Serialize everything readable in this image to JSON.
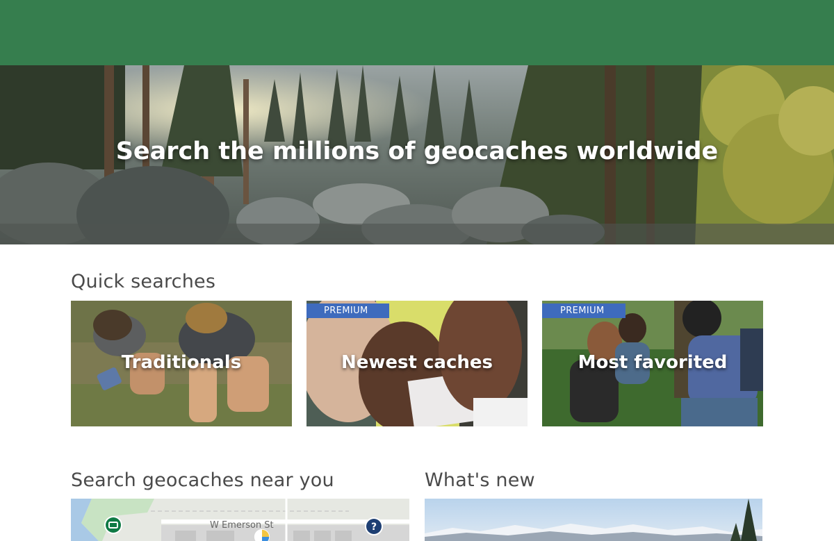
{
  "header": {
    "brand_color": "#367e4e"
  },
  "hero": {
    "title": "Search the millions of geocaches worldwide"
  },
  "quick_searches": {
    "title": "Quick searches",
    "cards": [
      {
        "label": "Traditionals",
        "badge": ""
      },
      {
        "label": "Newest caches",
        "badge": "PREMIUM"
      },
      {
        "label": "Most favorited",
        "badge": "PREMIUM"
      }
    ],
    "badge_color": "#3e6bbd"
  },
  "near_you": {
    "title": "Search geocaches near you",
    "map": {
      "street_label": "W Emerson St",
      "icons": [
        "traditional-cache-icon",
        "unknown-cache-icon",
        "multi-cache-icon"
      ]
    }
  },
  "whats_new": {
    "title": "What's new"
  }
}
